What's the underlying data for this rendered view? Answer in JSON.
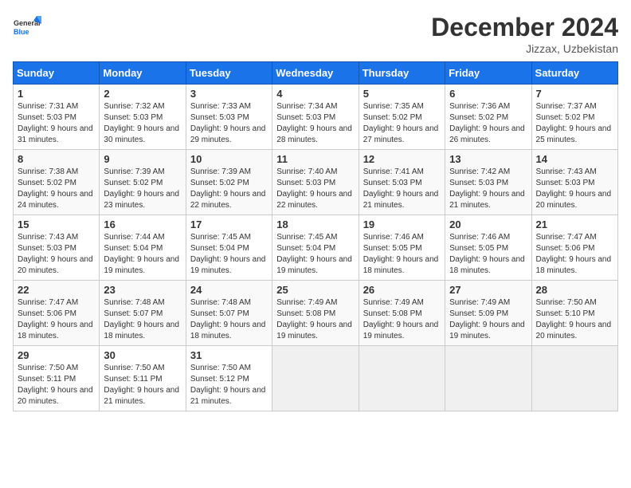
{
  "header": {
    "logo_text_general": "General",
    "logo_text_blue": "Blue",
    "month": "December 2024",
    "location": "Jizzax, Uzbekistan"
  },
  "days_of_week": [
    "Sunday",
    "Monday",
    "Tuesday",
    "Wednesday",
    "Thursday",
    "Friday",
    "Saturday"
  ],
  "weeks": [
    [
      {
        "day": "1",
        "info": "Sunrise: 7:31 AM\nSunset: 5:03 PM\nDaylight: 9 hours and 31 minutes."
      },
      {
        "day": "2",
        "info": "Sunrise: 7:32 AM\nSunset: 5:03 PM\nDaylight: 9 hours and 30 minutes."
      },
      {
        "day": "3",
        "info": "Sunrise: 7:33 AM\nSunset: 5:03 PM\nDaylight: 9 hours and 29 minutes."
      },
      {
        "day": "4",
        "info": "Sunrise: 7:34 AM\nSunset: 5:03 PM\nDaylight: 9 hours and 28 minutes."
      },
      {
        "day": "5",
        "info": "Sunrise: 7:35 AM\nSunset: 5:02 PM\nDaylight: 9 hours and 27 minutes."
      },
      {
        "day": "6",
        "info": "Sunrise: 7:36 AM\nSunset: 5:02 PM\nDaylight: 9 hours and 26 minutes."
      },
      {
        "day": "7",
        "info": "Sunrise: 7:37 AM\nSunset: 5:02 PM\nDaylight: 9 hours and 25 minutes."
      }
    ],
    [
      {
        "day": "8",
        "info": "Sunrise: 7:38 AM\nSunset: 5:02 PM\nDaylight: 9 hours and 24 minutes."
      },
      {
        "day": "9",
        "info": "Sunrise: 7:39 AM\nSunset: 5:02 PM\nDaylight: 9 hours and 23 minutes."
      },
      {
        "day": "10",
        "info": "Sunrise: 7:39 AM\nSunset: 5:02 PM\nDaylight: 9 hours and 22 minutes."
      },
      {
        "day": "11",
        "info": "Sunrise: 7:40 AM\nSunset: 5:03 PM\nDaylight: 9 hours and 22 minutes."
      },
      {
        "day": "12",
        "info": "Sunrise: 7:41 AM\nSunset: 5:03 PM\nDaylight: 9 hours and 21 minutes."
      },
      {
        "day": "13",
        "info": "Sunrise: 7:42 AM\nSunset: 5:03 PM\nDaylight: 9 hours and 21 minutes."
      },
      {
        "day": "14",
        "info": "Sunrise: 7:43 AM\nSunset: 5:03 PM\nDaylight: 9 hours and 20 minutes."
      }
    ],
    [
      {
        "day": "15",
        "info": "Sunrise: 7:43 AM\nSunset: 5:03 PM\nDaylight: 9 hours and 20 minutes."
      },
      {
        "day": "16",
        "info": "Sunrise: 7:44 AM\nSunset: 5:04 PM\nDaylight: 9 hours and 19 minutes."
      },
      {
        "day": "17",
        "info": "Sunrise: 7:45 AM\nSunset: 5:04 PM\nDaylight: 9 hours and 19 minutes."
      },
      {
        "day": "18",
        "info": "Sunrise: 7:45 AM\nSunset: 5:04 PM\nDaylight: 9 hours and 19 minutes."
      },
      {
        "day": "19",
        "info": "Sunrise: 7:46 AM\nSunset: 5:05 PM\nDaylight: 9 hours and 18 minutes."
      },
      {
        "day": "20",
        "info": "Sunrise: 7:46 AM\nSunset: 5:05 PM\nDaylight: 9 hours and 18 minutes."
      },
      {
        "day": "21",
        "info": "Sunrise: 7:47 AM\nSunset: 5:06 PM\nDaylight: 9 hours and 18 minutes."
      }
    ],
    [
      {
        "day": "22",
        "info": "Sunrise: 7:47 AM\nSunset: 5:06 PM\nDaylight: 9 hours and 18 minutes."
      },
      {
        "day": "23",
        "info": "Sunrise: 7:48 AM\nSunset: 5:07 PM\nDaylight: 9 hours and 18 minutes."
      },
      {
        "day": "24",
        "info": "Sunrise: 7:48 AM\nSunset: 5:07 PM\nDaylight: 9 hours and 18 minutes."
      },
      {
        "day": "25",
        "info": "Sunrise: 7:49 AM\nSunset: 5:08 PM\nDaylight: 9 hours and 19 minutes."
      },
      {
        "day": "26",
        "info": "Sunrise: 7:49 AM\nSunset: 5:08 PM\nDaylight: 9 hours and 19 minutes."
      },
      {
        "day": "27",
        "info": "Sunrise: 7:49 AM\nSunset: 5:09 PM\nDaylight: 9 hours and 19 minutes."
      },
      {
        "day": "28",
        "info": "Sunrise: 7:50 AM\nSunset: 5:10 PM\nDaylight: 9 hours and 20 minutes."
      }
    ],
    [
      {
        "day": "29",
        "info": "Sunrise: 7:50 AM\nSunset: 5:11 PM\nDaylight: 9 hours and 20 minutes."
      },
      {
        "day": "30",
        "info": "Sunrise: 7:50 AM\nSunset: 5:11 PM\nDaylight: 9 hours and 21 minutes."
      },
      {
        "day": "31",
        "info": "Sunrise: 7:50 AM\nSunset: 5:12 PM\nDaylight: 9 hours and 21 minutes."
      },
      {
        "day": "",
        "info": ""
      },
      {
        "day": "",
        "info": ""
      },
      {
        "day": "",
        "info": ""
      },
      {
        "day": "",
        "info": ""
      }
    ]
  ]
}
